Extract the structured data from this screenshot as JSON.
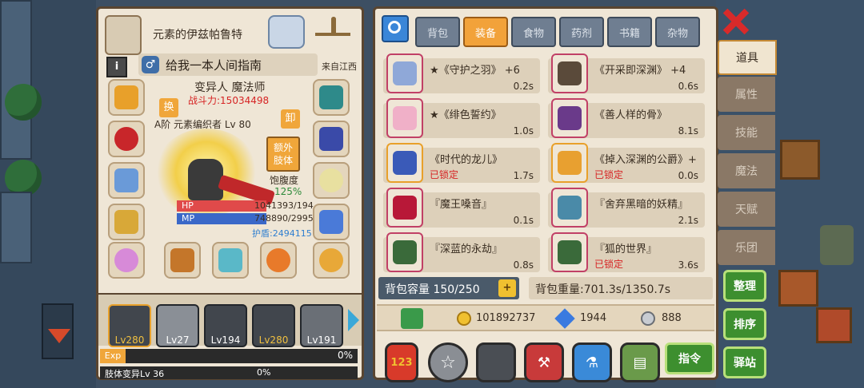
{
  "character": {
    "title": "元素的伊兹帕鲁特",
    "name": "给我一本人间指南",
    "origin": "来自江西",
    "class_line": "变异人 魔法师",
    "power": "战斗力:15034498",
    "swap_label": "换",
    "unequip_label": "卸",
    "extra_limbs_label": "额外肢体",
    "subline": "A阶 元素编织者 Lv 80",
    "satiety_label": "饱腹度",
    "satiety_value": "125%",
    "hp_label": "HP",
    "hp_value": "1041393/194",
    "mp_label": "MP",
    "mp_value": "748890/2995",
    "shield_value": "护盾:2494115"
  },
  "heroes": [
    {
      "level": "Lv280"
    },
    {
      "level": "Lv27"
    },
    {
      "level": "Lv194"
    },
    {
      "level": "Lv280"
    },
    {
      "level": "Lv191"
    }
  ],
  "exp": {
    "label": "Exp",
    "value": "0%",
    "sub_label": "肢体变异Lv 36",
    "sub_value": "0%"
  },
  "tabs": [
    "背包",
    "装备",
    "食物",
    "药剂",
    "书籍",
    "杂物"
  ],
  "active_tab": "装备",
  "items": [
    {
      "name": "★《守护之羽》 +6",
      "weight": "0.2s",
      "locked": "",
      "color": "#8fa8d8"
    },
    {
      "name": "《开采即深渊》 +4",
      "weight": "0.6s",
      "locked": "",
      "color": "#5a4a3a"
    },
    {
      "name": "★《绯色誓约》",
      "weight": "1.0s",
      "locked": "",
      "color": "#f0b0c8"
    },
    {
      "name": "《善人样的骨》",
      "weight": "8.1s",
      "locked": "",
      "color": "#6a3a8a"
    },
    {
      "name": "《时代的龙儿》",
      "weight": "1.7s",
      "locked": "已锁定",
      "color": "#3a5ab8"
    },
    {
      "name": "《掉入深渊的公爵》+",
      "weight": "0.0s",
      "locked": "已锁定",
      "color": "#e8a030"
    },
    {
      "name": "『魔王嗓音』",
      "weight": "0.1s",
      "locked": "",
      "color": "#b81838"
    },
    {
      "name": "『舍弃黑暗的妖精』",
      "weight": "2.1s",
      "locked": "",
      "color": "#4a8aa8"
    },
    {
      "name": "『深蓝的永劫』",
      "weight": "0.8s",
      "locked": "",
      "color": "#3a6a3a"
    },
    {
      "name": "『狐的世界』",
      "weight": "3.6s",
      "locked": "已锁定",
      "color": "#3a6a3a"
    }
  ],
  "bag": {
    "capacity": "背包容量 150/250",
    "weight": "背包重量:701.3s/1350.7s"
  },
  "currency": {
    "gold": "101892737",
    "diamond": "1944",
    "silver": "888"
  },
  "side_tabs": [
    "道具",
    "属性",
    "技能",
    "魔法",
    "天赋",
    "乐团"
  ],
  "actions": {
    "command": "指令",
    "organize": "整理",
    "sort": "排序",
    "station": "驿站"
  }
}
